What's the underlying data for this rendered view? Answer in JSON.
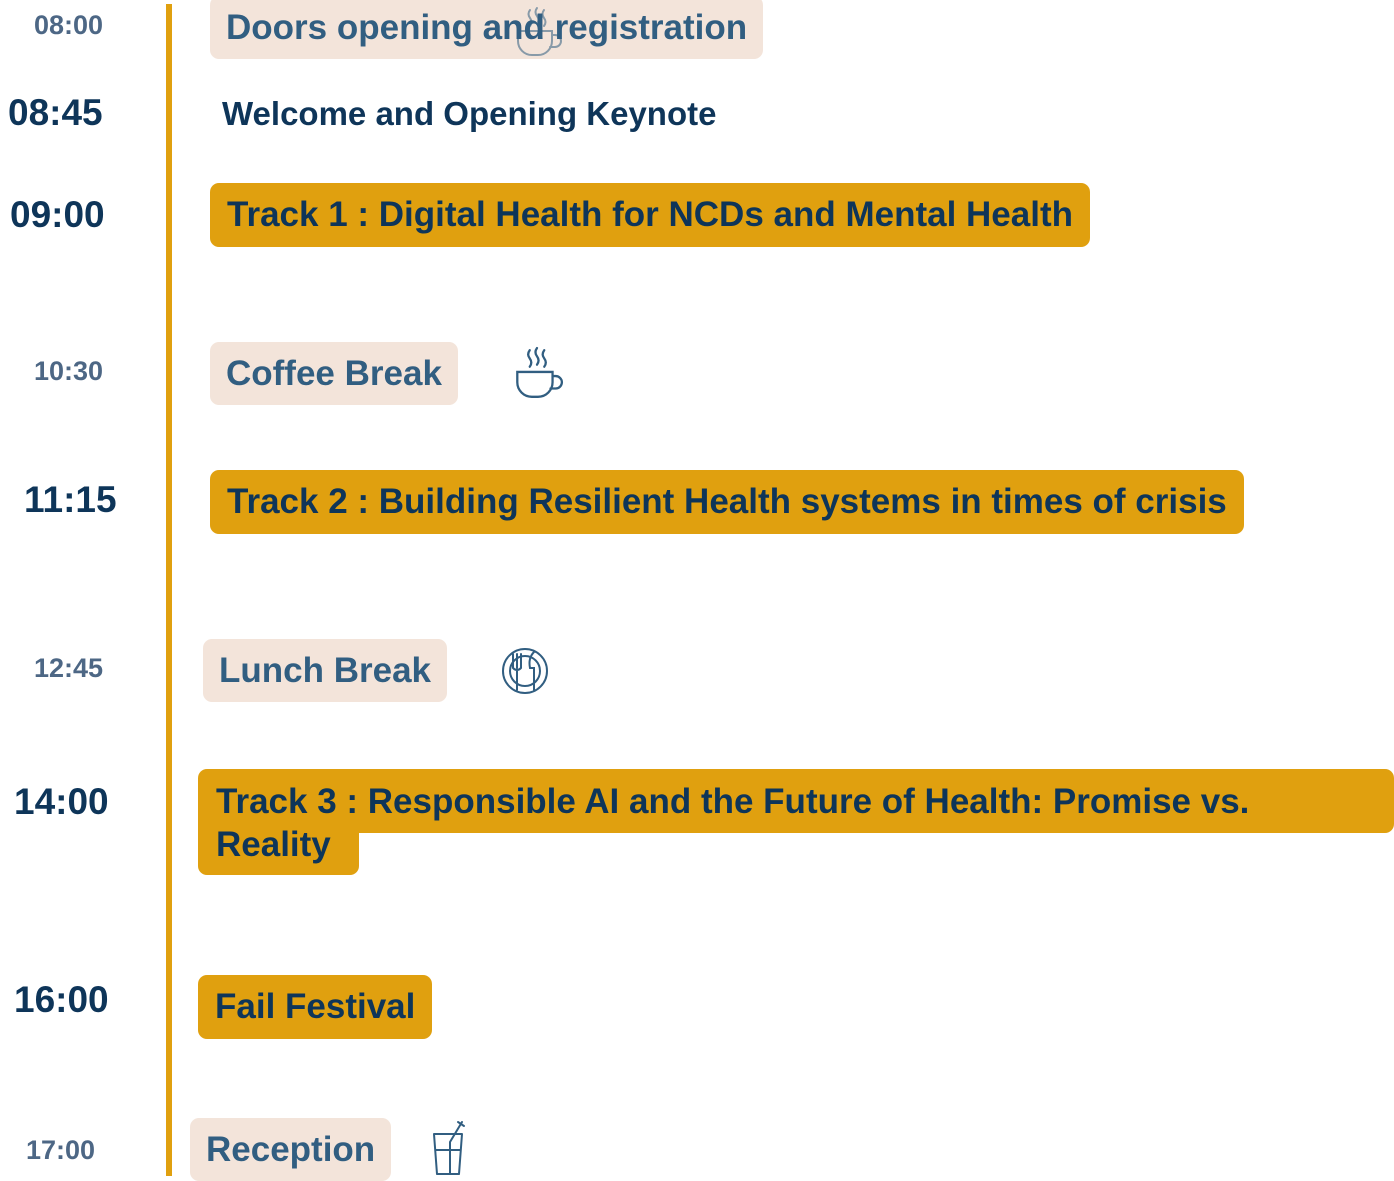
{
  "schedule": {
    "items": [
      {
        "time": "08:00",
        "title": "Doors opening and registration",
        "kind": "break",
        "icon": "coffee-cup-icon"
      },
      {
        "time": "08:45",
        "title": "Welcome and Opening Keynote",
        "kind": "plain"
      },
      {
        "time": "09:00",
        "title": "Track 1 : Digital Health for NCDs and Mental Health",
        "kind": "track"
      },
      {
        "time": "10:30",
        "title": "Coffee Break",
        "kind": "break",
        "icon": "coffee-cup-icon"
      },
      {
        "time": "11:15",
        "title": "Track 2 : Building Resilient Health systems in times of crisis",
        "kind": "track"
      },
      {
        "time": "12:45",
        "title": "Lunch Break",
        "kind": "break",
        "icon": "plate-cutlery-icon"
      },
      {
        "time": "14:00",
        "title_line1": "Track 3 : Responsible AI and the Future of Health: Promise vs.",
        "title_line2": "Reality",
        "kind": "track"
      },
      {
        "time": "16:00",
        "title": "Fail Festival",
        "kind": "track"
      },
      {
        "time": "17:00",
        "title": "Reception",
        "kind": "break",
        "icon": "drink-glass-icon"
      }
    ]
  },
  "colors": {
    "accent_gold": "#e0a00f",
    "break_background": "#f3e4da",
    "navy_text": "#0e3559",
    "muted_blue_text": "#4d6785",
    "break_text": "#315e81"
  }
}
